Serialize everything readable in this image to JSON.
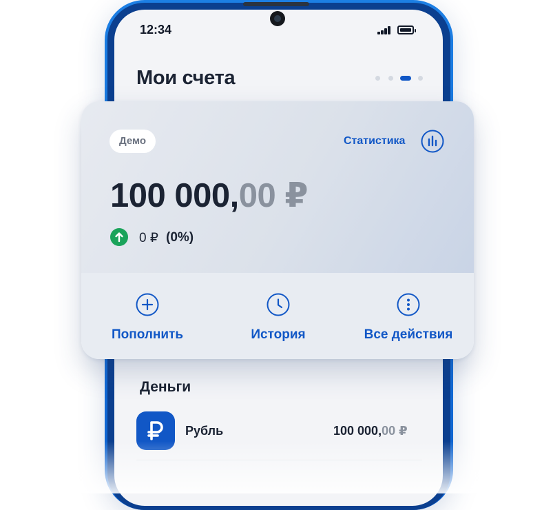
{
  "status_bar": {
    "time": "12:34",
    "icons": [
      "signal-icon",
      "battery-icon"
    ]
  },
  "header": {
    "title": "Мои счета",
    "page_indicator": {
      "count": 4,
      "active_index": 2
    }
  },
  "account_card": {
    "badge": "Демо",
    "statistics_label": "Статистика",
    "statistics_icon": "bar-chart-icon",
    "balance": {
      "main": "100 000,",
      "fraction": "00 ₽"
    },
    "change": {
      "icon": "arrow-up-icon",
      "amount": "0 ₽",
      "percent": "(0%)"
    },
    "actions": [
      {
        "label": "Пополнить",
        "icon": "plus-circle-icon"
      },
      {
        "label": "История",
        "icon": "clock-icon"
      },
      {
        "label": "Все действия",
        "icon": "more-vertical-icon"
      }
    ]
  },
  "money_section": {
    "title": "Деньги",
    "items": [
      {
        "name": "Рубль",
        "icon": "ruble-icon",
        "value_main": "100 000,",
        "value_fraction": "00 ₽"
      }
    ]
  },
  "colors": {
    "accent": "#1157c6",
    "positive": "#1aa35a",
    "text": "#1b2333",
    "muted": "#8a929e"
  }
}
